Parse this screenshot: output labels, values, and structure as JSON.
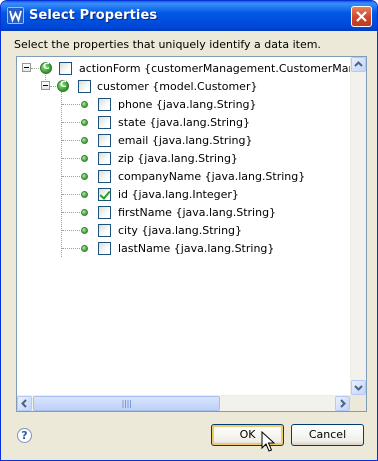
{
  "window": {
    "title": "Select Properties",
    "icon": "eclipse-w-icon"
  },
  "dialog": {
    "instruction": "Select the properties that uniquely identify a data item."
  },
  "tree": {
    "root": {
      "label": "actionForm {customerManagement.CustomerManageme",
      "checked": false,
      "expanded": true
    },
    "child": {
      "label": "customer {model.Customer}",
      "checked": false,
      "expanded": true
    },
    "fields": [
      {
        "label": "phone {java.lang.String}",
        "checked": false
      },
      {
        "label": "state {java.lang.String}",
        "checked": false
      },
      {
        "label": "email {java.lang.String}",
        "checked": false
      },
      {
        "label": "zip {java.lang.String}",
        "checked": false
      },
      {
        "label": "companyName {java.lang.String}",
        "checked": false
      },
      {
        "label": "id {java.lang.Integer}",
        "checked": true
      },
      {
        "label": "firstName {java.lang.String}",
        "checked": false
      },
      {
        "label": "city {java.lang.String}",
        "checked": false
      },
      {
        "label": "lastName {java.lang.String}",
        "checked": false
      }
    ]
  },
  "buttons": {
    "ok": "OK",
    "cancel": "Cancel",
    "help_glyph": "?"
  },
  "colors": {
    "titlebar": "#0058e6",
    "dialog_bg": "#ece9d8",
    "checkmark": "#21a121"
  }
}
